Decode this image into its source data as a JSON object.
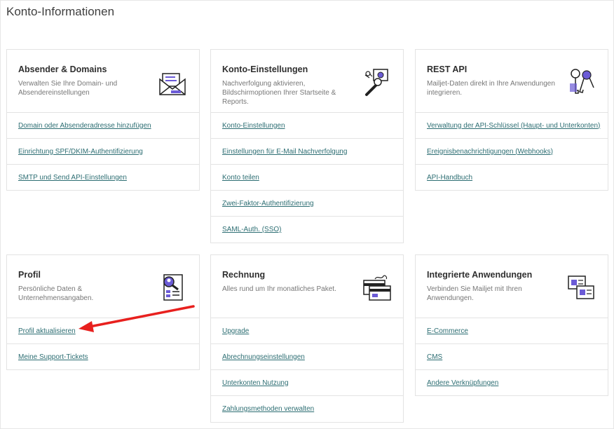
{
  "page": {
    "title": "Konto-Informationen"
  },
  "cards": [
    {
      "title": "Absender & Domains",
      "description": "Verwalten Sie Ihre Domain- und Absendereinstellungen",
      "icon": "envelope-letter-icon",
      "links": [
        "Domain oder Absenderadresse hinzufügen",
        "Einrichtung SPF/DKIM-Authentifizierung",
        "SMTP und Send API-Einstellungen"
      ]
    },
    {
      "title": "Konto-Einstellungen",
      "description": "Nachverfolgung aktivieren, Bildschirmoptionen Ihrer Startseite & Reports.",
      "icon": "wrench-gear-icon",
      "links": [
        "Konto-Einstellungen",
        "Einstellungen für E-Mail Nachverfolgung",
        "Konto teilen",
        "Zwei-Faktor-Authentifizierung",
        "SAML-Auth. (SSO)"
      ]
    },
    {
      "title": "REST API",
      "description": "Mailjet-Daten direkt in Ihre Anwendungen integrieren.",
      "icon": "keys-icon",
      "links": [
        "Verwaltung der API-Schlüssel (Haupt- und Unterkonten)",
        "Ereignisbenachrichtigungen (Webhooks)",
        "API-Handbuch"
      ]
    },
    {
      "title": "Profil",
      "description": "Persönliche Daten & Unternehmensangaben.",
      "icon": "profile-search-icon",
      "links": [
        "Profil aktualisieren",
        "Meine Support-Tickets"
      ]
    },
    {
      "title": "Rechnung",
      "description": "Alles rund um Ihr monatliches Paket.",
      "icon": "credit-card-icon",
      "links": [
        "Upgrade",
        "Abrechnungseinstellungen",
        "Unterkonten Nutzung",
        "Zahlungsmethoden verwalten"
      ]
    },
    {
      "title": "Integrierte Anwendungen",
      "description": "Verbinden Sie Mailjet mit Ihren Anwendungen.",
      "icon": "puzzle-cards-icon",
      "links": [
        "E-Commerce",
        "CMS",
        "Andere Verknüpfungen"
      ]
    }
  ],
  "colors": {
    "link": "#2d6e73",
    "accent": "#6b5bd6",
    "annotation_arrow": "#e8201e"
  }
}
